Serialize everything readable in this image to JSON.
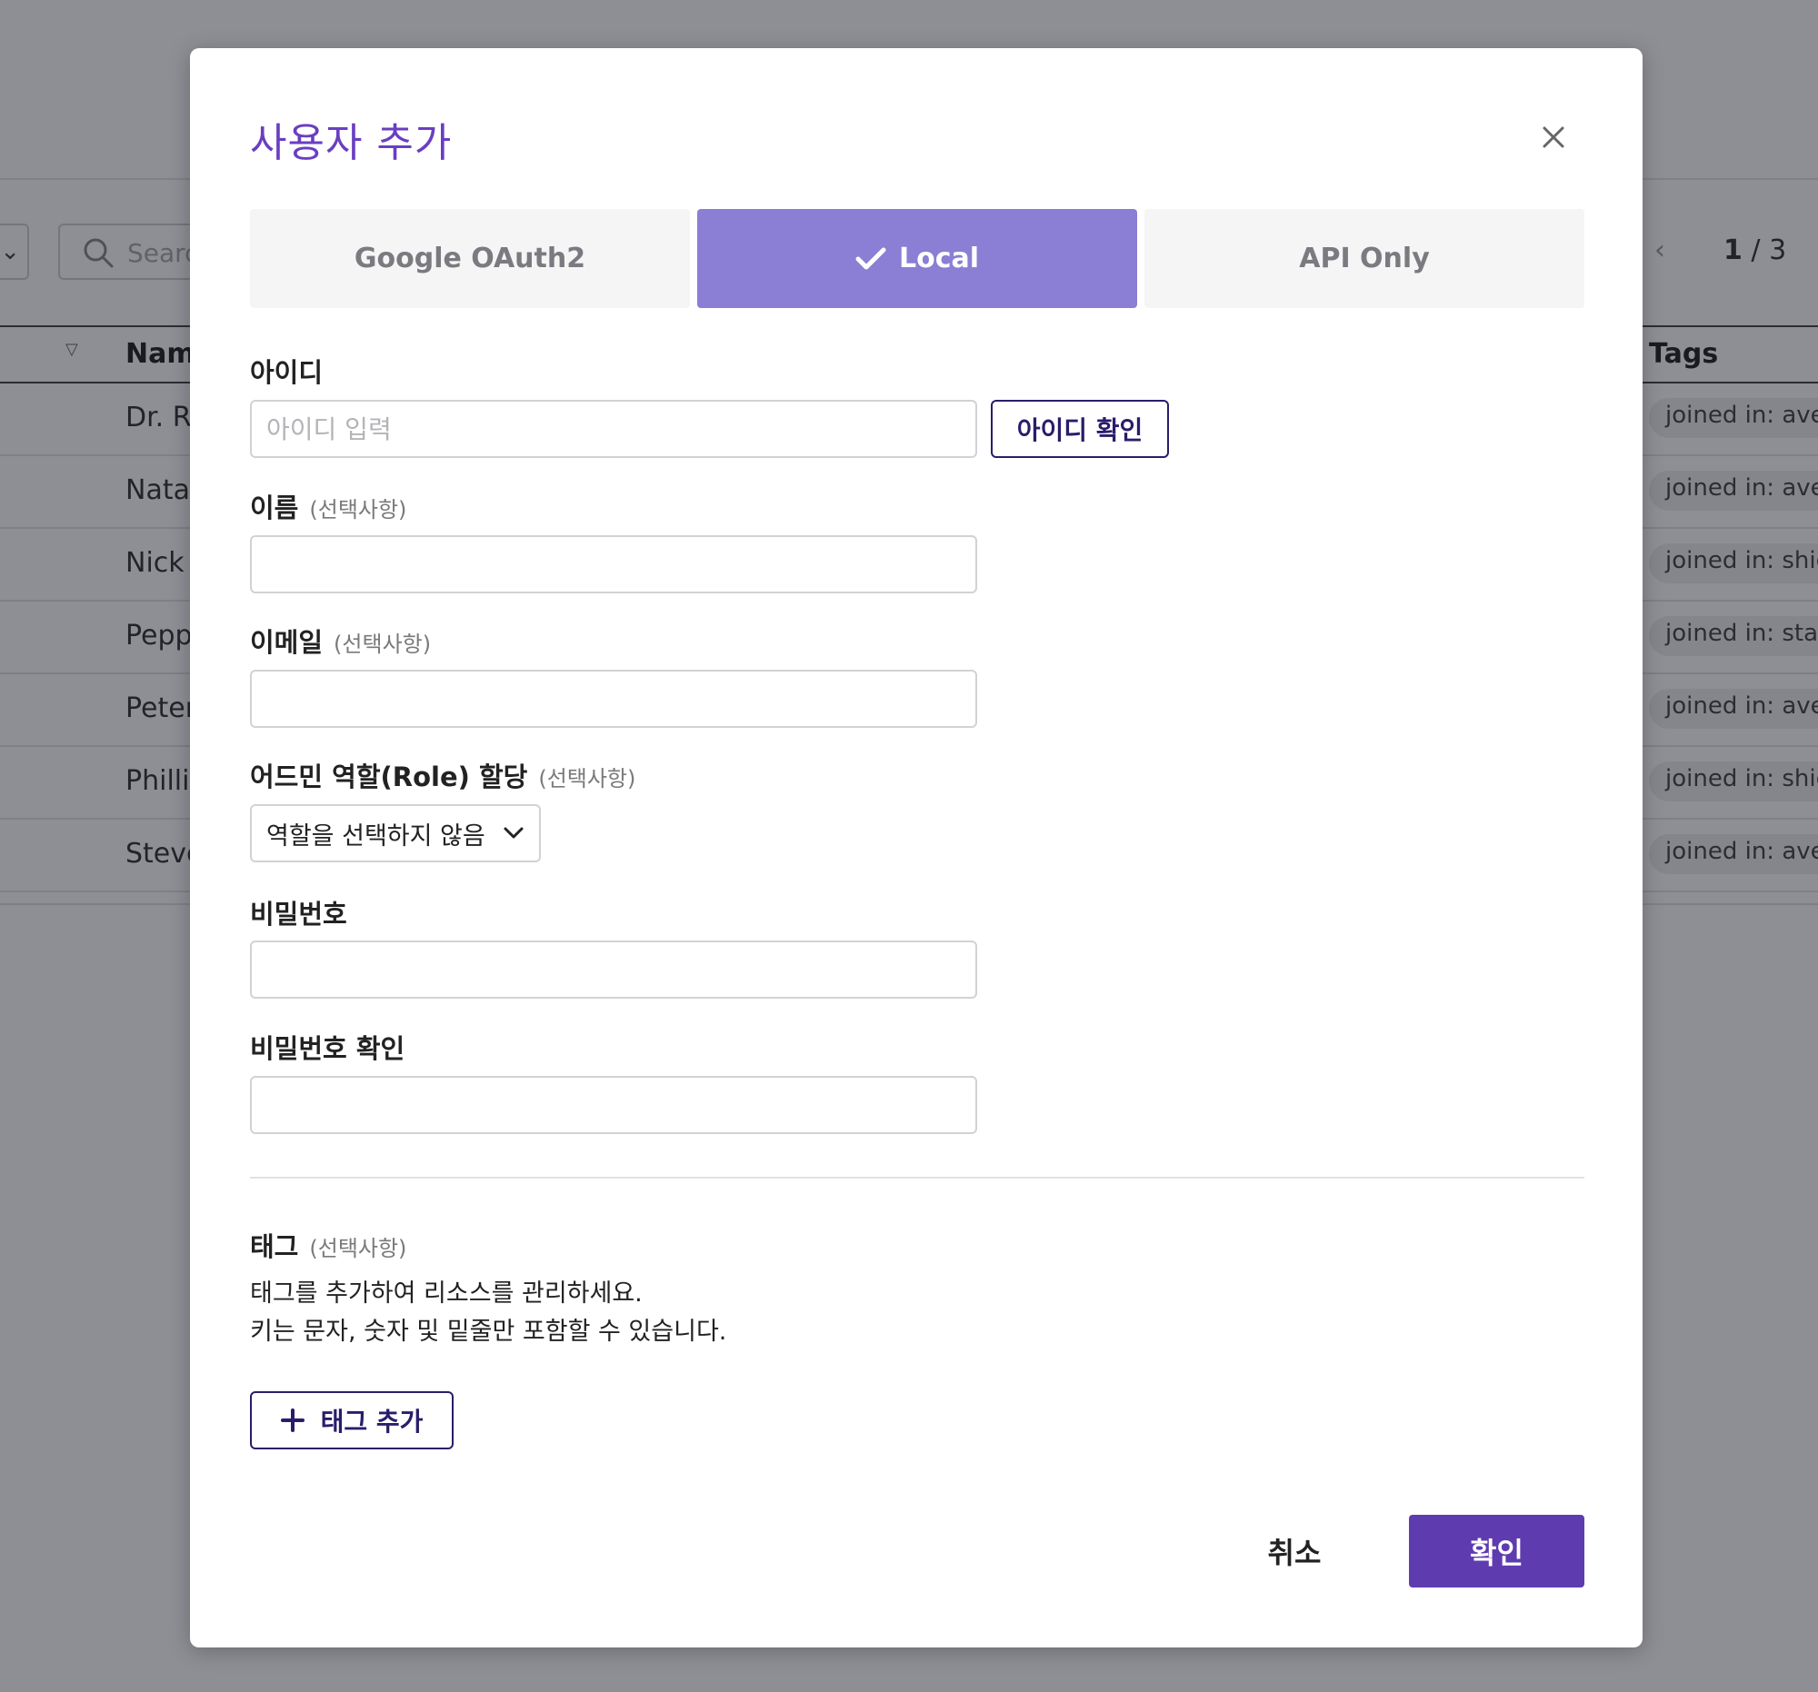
{
  "background": {
    "search_placeholder": "Search",
    "pager": {
      "current": "1",
      "separator": " / ",
      "total": "3"
    },
    "table": {
      "columns": {
        "name": "Name",
        "tags": "Tags"
      },
      "rows": [
        {
          "name": "Dr. Ro",
          "tag": "joined in: avengers"
        },
        {
          "name": "Natasha",
          "tag": "joined in: avengers"
        },
        {
          "name": "Nick F",
          "tag": "joined in: shield"
        },
        {
          "name": "Pepper",
          "tag": "joined in: stark"
        },
        {
          "name": "Peter",
          "tag": "joined in: avengers"
        },
        {
          "name": "Phillip",
          "tag": "joined in: shield"
        },
        {
          "name": "Steve",
          "tag": "joined in: avengers"
        }
      ]
    }
  },
  "modal": {
    "title": "사용자 추가",
    "tabs": [
      {
        "label": "Google OAuth2",
        "active": false
      },
      {
        "label": "Local",
        "active": true
      },
      {
        "label": "API Only",
        "active": false
      }
    ],
    "fields": {
      "id": {
        "label": "아이디",
        "placeholder": "아이디 입력",
        "value": "",
        "check_button": "아이디 확인"
      },
      "name": {
        "label": "이름",
        "optional": "(선택사항)",
        "value": ""
      },
      "email": {
        "label": "이메일",
        "optional": "(선택사항)",
        "value": ""
      },
      "role": {
        "label": "어드민 역할(Role) 할당",
        "optional": "(선택사항)",
        "selected": "역할을 선택하지 않음"
      },
      "password": {
        "label": "비밀번호",
        "value": ""
      },
      "password_confirm": {
        "label": "비밀번호 확인",
        "value": ""
      }
    },
    "tags": {
      "label": "태그",
      "optional": "(선택사항)",
      "help_line1": "태그를 추가하여 리소스를 관리하세요.",
      "help_line2": "키는 문자, 숫자 및 밑줄만 포함할 수 있습니다.",
      "add_button": "태그 추가"
    },
    "footer": {
      "cancel": "취소",
      "confirm": "확인"
    }
  },
  "colors": {
    "accent": "#5e3cb0",
    "title": "#6a3ec2",
    "active_tab": "#8a7fd4",
    "outline_button": "#2b1c6b"
  }
}
